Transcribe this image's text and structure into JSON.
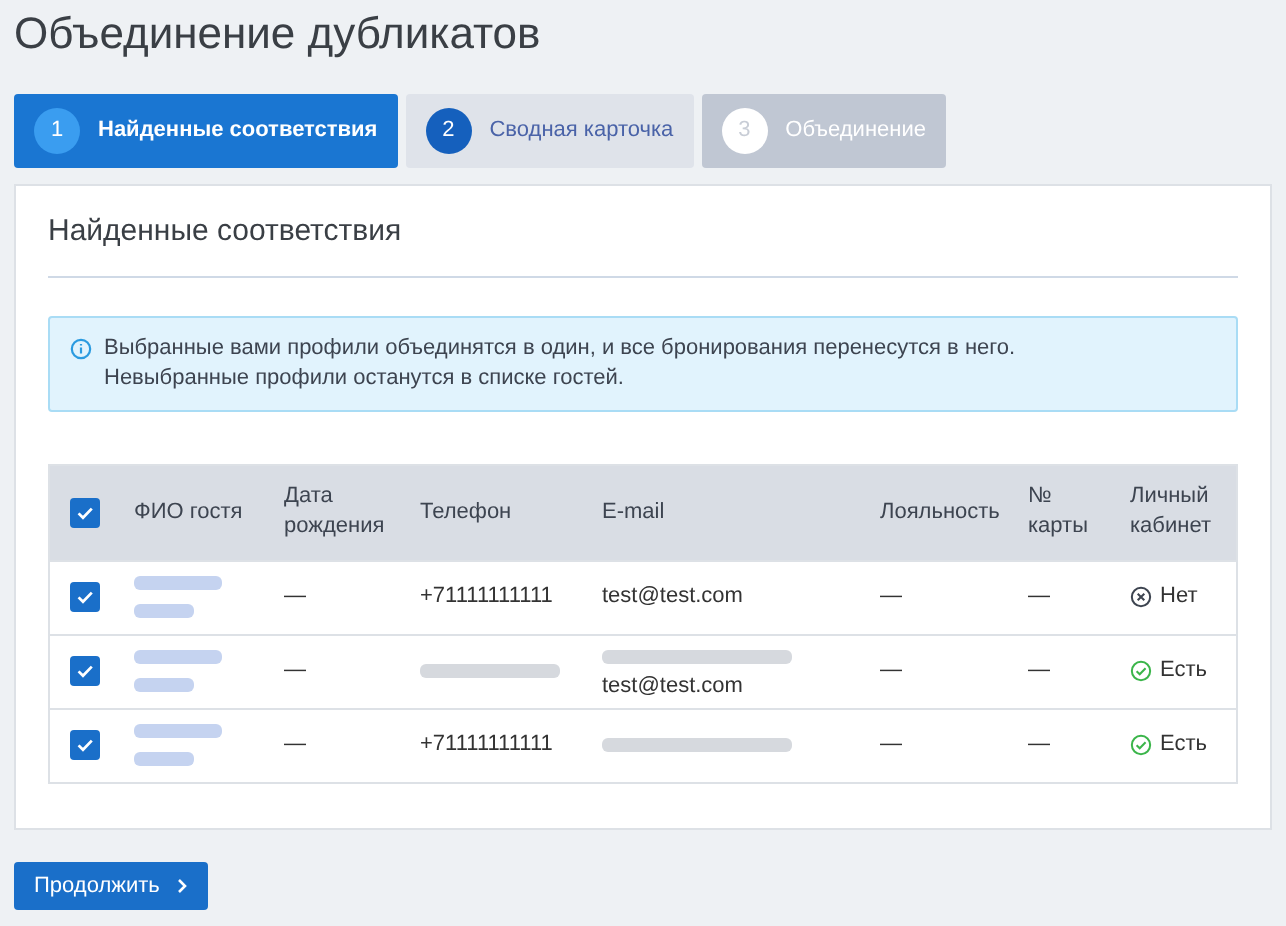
{
  "title": "Объединение дубликатов",
  "steps": [
    {
      "number": "1",
      "label": "Найденные соответствия",
      "selected": true,
      "disabled": false
    },
    {
      "number": "2",
      "label": "Сводная карточка",
      "selected": false,
      "disabled": false
    },
    {
      "number": "3",
      "label": "Объединение",
      "selected": false,
      "disabled": true
    }
  ],
  "card": {
    "title": "Найденные соответствия",
    "info": [
      "Выбранные вами профили объединятся в один, и все бронирования перенесутся в него.",
      "Невыбранные профили останутся в списке гостей."
    ],
    "table": {
      "all_checked": true,
      "columns": [
        "ФИО гостя",
        "Дата рождения",
        "Телефон",
        "E-mail",
        "Лояльность",
        "№ карты",
        "Личный кабинет"
      ],
      "rows": [
        {
          "checked": true,
          "name": {
            "kind": "redacted_two_lines"
          },
          "birth": "—",
          "phone": {
            "kind": "text",
            "text": "+71111111111"
          },
          "emails": [
            {
              "kind": "text",
              "text": "test@test.com"
            }
          ],
          "loyalty": "—",
          "card": "—",
          "account": {
            "has": false,
            "text": "Нет"
          }
        },
        {
          "checked": true,
          "name": {
            "kind": "redacted_two_lines"
          },
          "birth": "—",
          "phone": {
            "kind": "redacted"
          },
          "emails": [
            {
              "kind": "redacted"
            },
            {
              "kind": "text",
              "text": "test@test.com"
            }
          ],
          "loyalty": "—",
          "card": "—",
          "account": {
            "has": true,
            "text": "Есть"
          }
        },
        {
          "checked": true,
          "name": {
            "kind": "redacted_two_lines"
          },
          "birth": "—",
          "phone": {
            "kind": "text",
            "text": "+71111111111"
          },
          "emails": [
            {
              "kind": "redacted"
            }
          ],
          "loyalty": "—",
          "card": "—",
          "account": {
            "has": true,
            "text": "Есть"
          }
        }
      ]
    }
  },
  "continue_button": "Продолжить"
}
